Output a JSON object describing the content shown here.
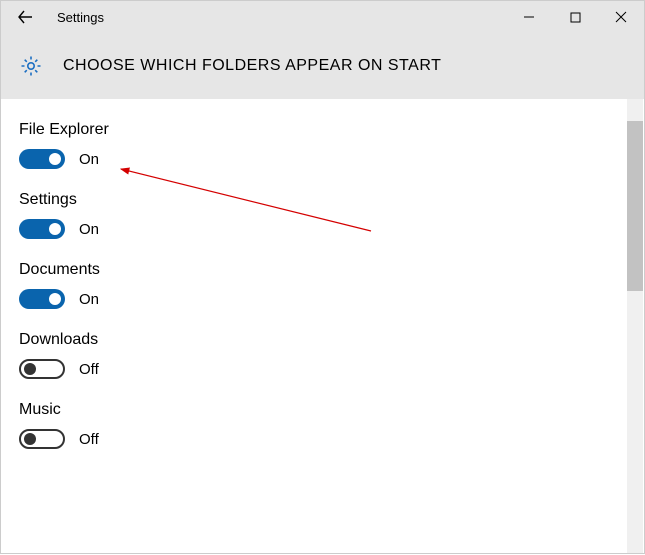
{
  "titlebar": {
    "title": "Settings"
  },
  "header": {
    "page_title": "CHOOSE WHICH FOLDERS APPEAR ON START"
  },
  "options": [
    {
      "label": "File Explorer",
      "on": true,
      "state_text": "On"
    },
    {
      "label": "Settings",
      "on": true,
      "state_text": "On"
    },
    {
      "label": "Documents",
      "on": true,
      "state_text": "On"
    },
    {
      "label": "Downloads",
      "on": false,
      "state_text": "Off"
    },
    {
      "label": "Music",
      "on": false,
      "state_text": "Off"
    }
  ],
  "colors": {
    "accent": "#0a64ad",
    "header_bg": "#e6e6e6"
  }
}
